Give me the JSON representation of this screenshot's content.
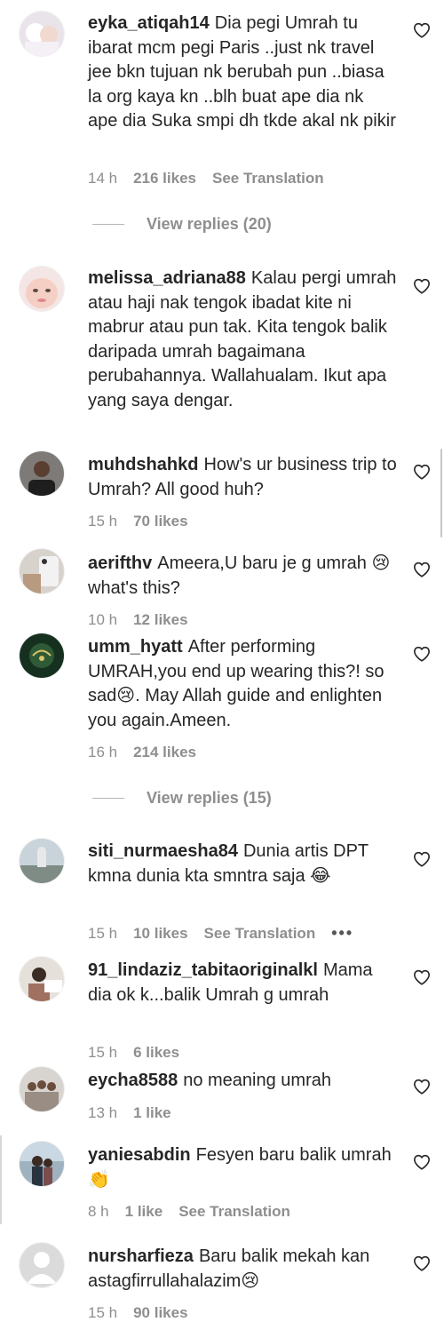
{
  "comments": [
    {
      "user": "eyka_atiqah14",
      "text": "Dia pegi Umrah tu ibarat mcm pegi Paris ..just nk travel jee bkn tujuan nk berubah pun ..biasa la org kaya kn ..blh buat ape dia nk ape dia Suka smpi dh tkde akal nk pikir",
      "time": "14 h",
      "likes": "216 likes",
      "translate": "See Translation"
    },
    {
      "user": "melissa_adriana88",
      "text": "Kalau pergi umrah atau haji nak tengok ibadat kite ni mabrur atau pun tak. Kita tengok balik daripada umrah bagaimana perubahannya. Wallahualam. Ikut apa yang saya dengar."
    },
    {
      "user": "muhdshahkd",
      "text": "How's ur business trip to Umrah? All good huh?",
      "time": "15 h",
      "likes": "70 likes"
    },
    {
      "user": "aerifthv",
      "text": "Ameera,U baru je g umrah 😢 what's this?",
      "time": "10 h",
      "likes": "12 likes"
    },
    {
      "user": "umm_hyatt",
      "text": "After performing UMRAH,you end up wearing this?! so sad😢. May Allah guide and enlighten you again.Ameen.",
      "time": "16 h",
      "likes": "214 likes"
    },
    {
      "user": "siti_nurmaesha84",
      "text": "Dunia artis DPT kmna dunia kta smntra saja 😂",
      "time": "15 h",
      "likes": "10 likes",
      "translate": "See Translation",
      "more": "•••"
    },
    {
      "user": "91_lindaziz_tabitaoriginalkl",
      "text": "Mama dia ok k...balik Umrah g umrah",
      "time": "15 h",
      "likes": "6 likes"
    },
    {
      "user": "eycha8588",
      "text": "no meaning umrah",
      "time": "13 h",
      "likes": "1 like"
    },
    {
      "user": "yaniesabdin",
      "text": "Fesyen baru balik umrah 👏",
      "time": "8 h",
      "likes": "1 like",
      "translate": "See Translation"
    },
    {
      "user": "nursharfieza",
      "text": "Baru balik mekah kan astagfirrullahalazim😢",
      "time": "15 h",
      "likes": "90 likes"
    }
  ],
  "replies": [
    {
      "label": "View replies (20)"
    },
    {
      "label": "View replies (15)"
    }
  ]
}
